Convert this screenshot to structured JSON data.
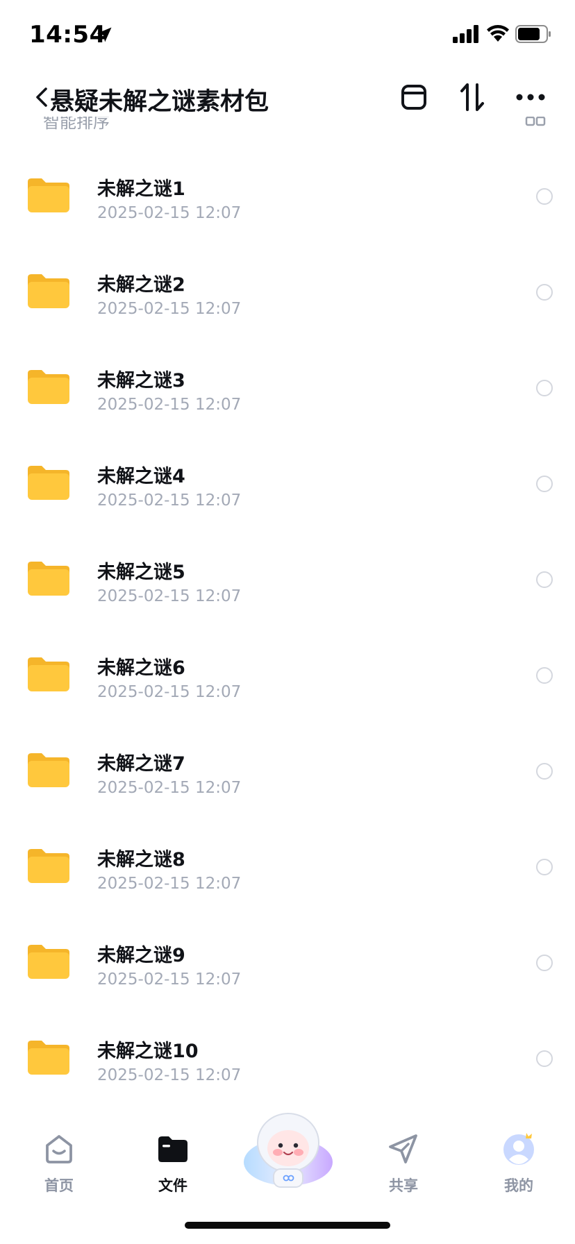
{
  "status_bar": {
    "time": "14:54"
  },
  "header": {
    "title": "悬疑未解之谜素材包"
  },
  "sort_row": {
    "label": "智能排序"
  },
  "files": [
    {
      "name": "未解之谜1",
      "date": "2025-02-15 12:07"
    },
    {
      "name": "未解之谜2",
      "date": "2025-02-15 12:07"
    },
    {
      "name": "未解之谜3",
      "date": "2025-02-15 12:07"
    },
    {
      "name": "未解之谜4",
      "date": "2025-02-15 12:07"
    },
    {
      "name": "未解之谜5",
      "date": "2025-02-15 12:07"
    },
    {
      "name": "未解之谜6",
      "date": "2025-02-15 12:07"
    },
    {
      "name": "未解之谜7",
      "date": "2025-02-15 12:07"
    },
    {
      "name": "未解之谜8",
      "date": "2025-02-15 12:07"
    },
    {
      "name": "未解之谜9",
      "date": "2025-02-15 12:07"
    },
    {
      "name": "未解之谜10",
      "date": "2025-02-15 12:07"
    }
  ],
  "tabs": {
    "home": "首页",
    "files": "文件",
    "share": "共享",
    "mine": "我的",
    "active": "files"
  },
  "colors": {
    "folder": "#ffc83d",
    "folder_tab": "#f5b52a",
    "text_primary": "#111318",
    "text_secondary": "#a3a9b6",
    "tab_inactive": "#8d94a3"
  }
}
